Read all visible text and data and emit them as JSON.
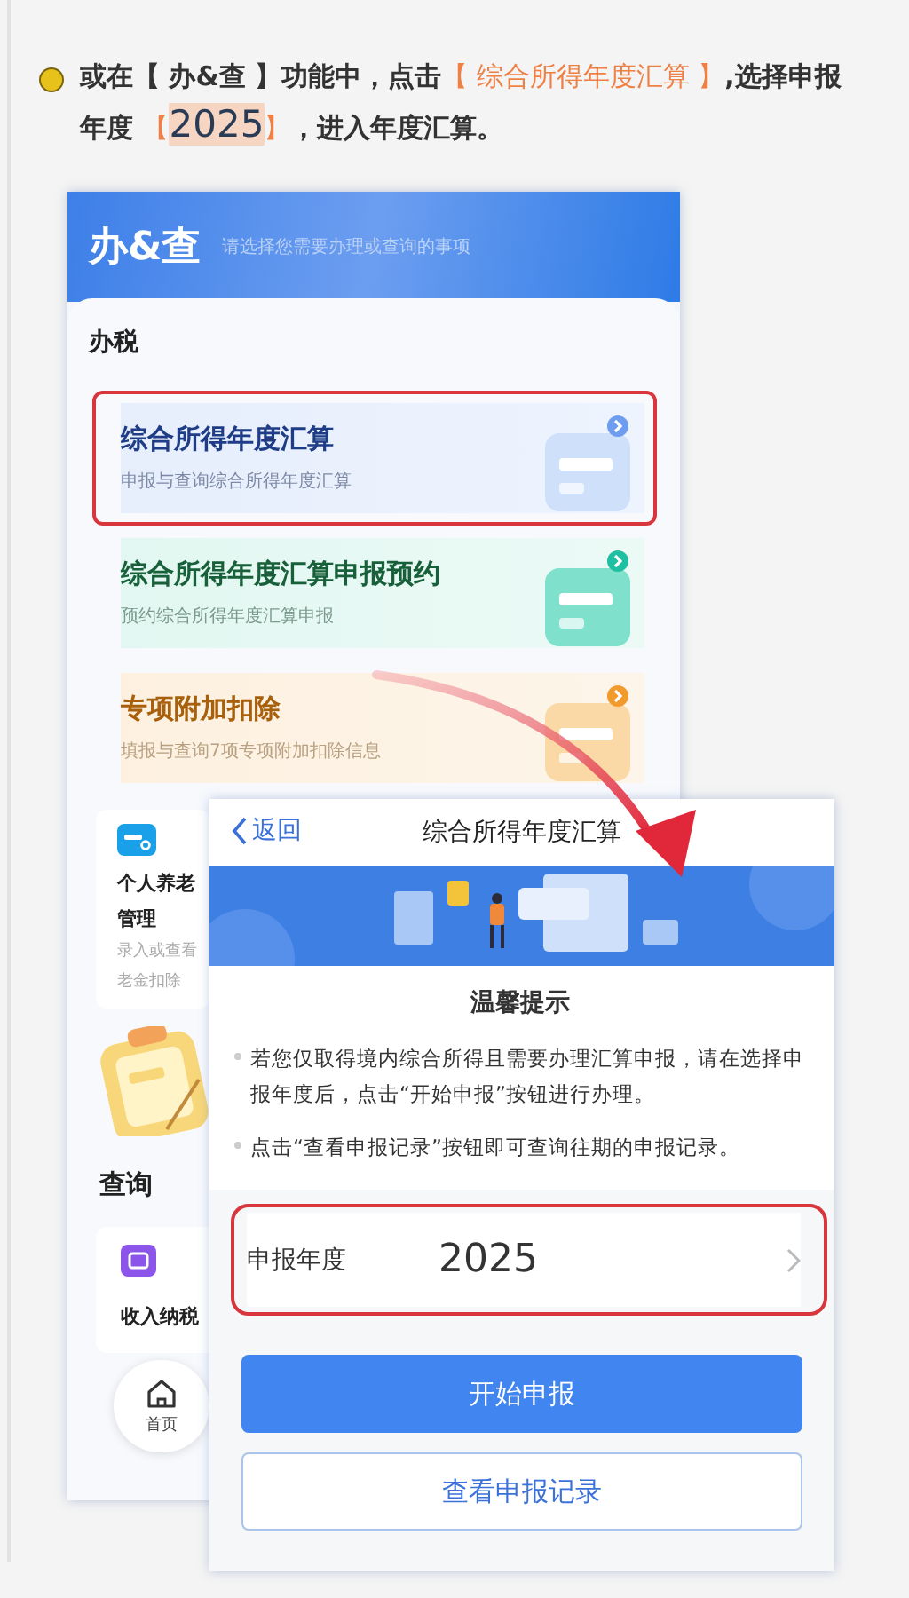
{
  "instruction": {
    "segments": [
      {
        "text": "或在【 办&查 】功能中，点击",
        "kind": "plain"
      },
      {
        "text": "【 综合所得年度汇算 】",
        "kind": "accent"
      },
      {
        "text": ",选择申报年度 ",
        "kind": "plain"
      },
      {
        "text": "【",
        "kind": "accent"
      },
      {
        "text": "2025",
        "kind": "year"
      },
      {
        "text": "】",
        "kind": "accent"
      },
      {
        "text": "，进入年度汇算。",
        "kind": "plain"
      }
    ]
  },
  "back_screen": {
    "header": {
      "title": "办&查",
      "subtitle": "请选择您需要办理或查询的事项"
    },
    "section_tax": "办税",
    "tax_items": [
      {
        "title": "综合所得年度汇算",
        "subtitle": "申报与查询综合所得年度汇算",
        "highlighted": true
      },
      {
        "title": "综合所得年度汇算申报预约",
        "subtitle": "预约综合所得年度汇算申报",
        "highlighted": false
      },
      {
        "title": "专项附加扣除",
        "subtitle": "填报与查询7项专项附加扣除信息",
        "highlighted": false
      }
    ],
    "pension_tile": {
      "title_lines": [
        "个人养老",
        "管理"
      ],
      "desc_lines": [
        "录入或查看",
        "老金扣除"
      ]
    },
    "section_query": "查询",
    "income_tile": {
      "title": "收入纳税"
    },
    "bottom_nav": {
      "label": "首页"
    }
  },
  "front_screen": {
    "nav": {
      "back": "返回",
      "title": "综合所得年度汇算"
    },
    "notice_title": "温馨提示",
    "notice_items": [
      "若您仅取得境内综合所得且需要办理汇算申报，请在选择申报年度后，点击“开始申报”按钮进行办理。",
      "点击“查看申报记录”按钮即可查询往期的申报记录。"
    ],
    "year_row": {
      "label": "申报年度",
      "value": "2025",
      "highlighted": true
    },
    "buttons": [
      {
        "label": "开始申报",
        "kind": "primary"
      },
      {
        "label": "查看申报记录",
        "kind": "secondary"
      }
    ]
  }
}
